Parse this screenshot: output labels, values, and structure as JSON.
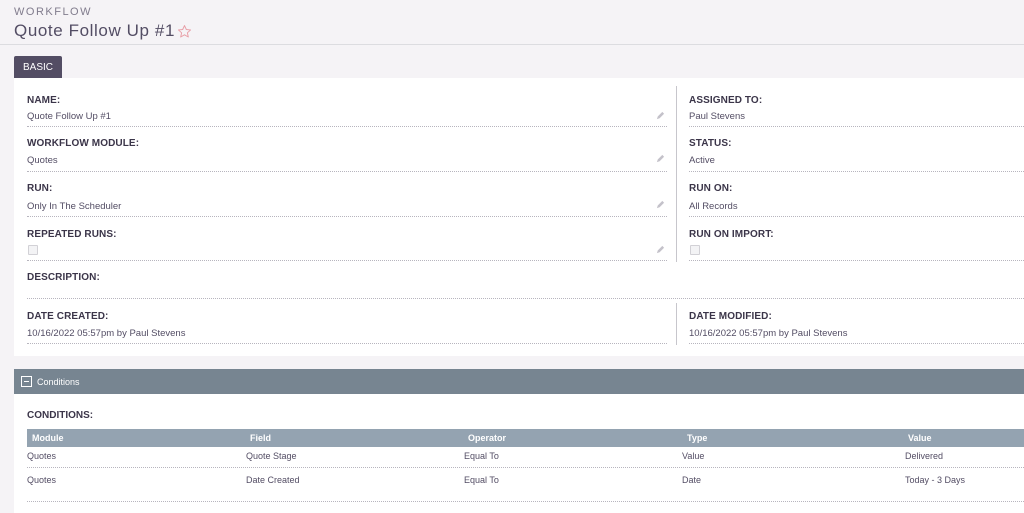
{
  "header": {
    "module": "WORKFLOW",
    "title": "Quote Follow Up #1"
  },
  "tabs": [
    {
      "label": "BASIC"
    }
  ],
  "fields": {
    "name": {
      "label": "NAME:",
      "value": "Quote Follow Up #1"
    },
    "assigned_to": {
      "label": "ASSIGNED TO:",
      "value": "Paul Stevens"
    },
    "workflow_module": {
      "label": "WORKFLOW MODULE:",
      "value": "Quotes"
    },
    "status": {
      "label": "STATUS:",
      "value": "Active"
    },
    "run": {
      "label": "RUN:",
      "value": "Only In The Scheduler"
    },
    "run_on": {
      "label": "RUN ON:",
      "value": "All Records"
    },
    "repeated_runs": {
      "label": "REPEATED RUNS:",
      "checked": false
    },
    "run_on_import": {
      "label": "RUN ON IMPORT:",
      "checked": false
    },
    "description": {
      "label": "DESCRIPTION:",
      "value": ""
    },
    "date_created": {
      "label": "DATE CREATED:",
      "value": "10/16/2022 05:57pm by Paul Stevens"
    },
    "date_modified": {
      "label": "DATE MODIFIED:",
      "value": "10/16/2022 05:57pm by Paul Stevens"
    }
  },
  "conditions_section": {
    "title": "Conditions",
    "label": "CONDITIONS:",
    "columns": [
      "Module",
      "Field",
      "Operator",
      "Type",
      "Value"
    ],
    "rows": [
      [
        "Quotes",
        "Quote Stage",
        "Equal To",
        "Value",
        "Delivered"
      ],
      [
        "Quotes",
        "Date Created",
        "Equal To",
        "Date",
        "Today - 3 Days"
      ]
    ]
  },
  "colors": {
    "tab": "#534d64",
    "section_bar": "#778591",
    "table_header": "#94a3b1",
    "star_outline": "#e8a0a8"
  },
  "icons": [
    "star-icon",
    "edit-pencil-icon",
    "collapse-minus-icon"
  ]
}
